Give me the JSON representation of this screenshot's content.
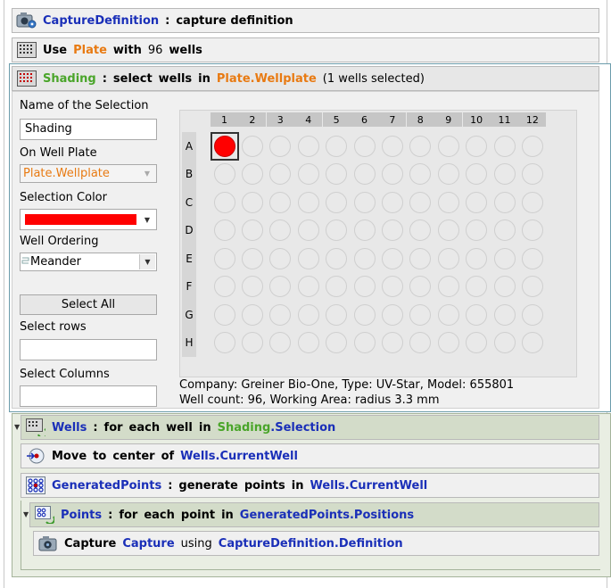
{
  "colors": {
    "accent_blue": "#1a2fb8",
    "accent_orange": "#e87a12",
    "accent_green": "#4aa52a",
    "selected_well": "#ff0000",
    "panel_border": "#6b9cab"
  },
  "capture_def": {
    "name": "CaptureDefinition",
    "sep": ":",
    "desc": "capture definition",
    "icon": "camera-gear-icon"
  },
  "use_plate": {
    "use": "Use",
    "plate": "Plate",
    "with": "with",
    "count": "96",
    "wells": "wells",
    "icon": "plate-grid-icon"
  },
  "shading": {
    "name": "Shading",
    "sep": ":",
    "select": "select",
    "wells": "wells",
    "in": "in",
    "plate_ref": "Plate.Wellplate",
    "selected_info": "(1 wells selected)",
    "icon": "plate-grid-icon",
    "name_label": "Name of the Selection",
    "name_value": "Shading",
    "plate_label": "On Well Plate",
    "plate_value": "Plate.Wellplate",
    "color_label": "Selection Color",
    "color_value": "#ff0000",
    "ordering_label": "Well Ordering",
    "ordering_value": "Meander",
    "select_all": "Select All",
    "rows_label": "Select rows",
    "rows_value": "",
    "cols_label": "Select Columns",
    "cols_value": "",
    "columns": [
      "1",
      "2",
      "3",
      "4",
      "5",
      "6",
      "7",
      "8",
      "9",
      "10",
      "11",
      "12"
    ],
    "rows": [
      "A",
      "B",
      "C",
      "D",
      "E",
      "F",
      "G",
      "H"
    ],
    "selected_wells": [
      "A1"
    ],
    "plate_info_line1": "Company: Greiner Bio-One, Type: UV-Star, Model: 655801",
    "plate_info_line2": "Well count: 96, Working Area: radius 3.3 mm"
  },
  "wells_loop": {
    "name": "Wells",
    "sep": ":",
    "for": "for",
    "each": "each",
    "well": "well",
    "in": "in",
    "ref_a": "Shading",
    "ref_b": ".Selection",
    "icon": "loop-wells-icon"
  },
  "move": {
    "move": "Move",
    "to": "to",
    "center": "center",
    "of": "of",
    "ref": "Wells.CurrentWell",
    "icon": "move-target-icon"
  },
  "gen_points": {
    "name": "GeneratedPoints",
    "sep": ":",
    "generate": "generate",
    "points": "points",
    "in": "in",
    "ref": "Wells.CurrentWell",
    "icon": "points-grid-icon"
  },
  "points_loop": {
    "name": "Points",
    "sep": ":",
    "for": "for",
    "each": "each",
    "point": "point",
    "in": "in",
    "ref": "GeneratedPoints.Positions",
    "icon": "loop-points-icon"
  },
  "capture": {
    "capture": "Capture",
    "name": "Capture",
    "using": "using",
    "ref": "CaptureDefinition.Definition",
    "icon": "camera-icon"
  }
}
